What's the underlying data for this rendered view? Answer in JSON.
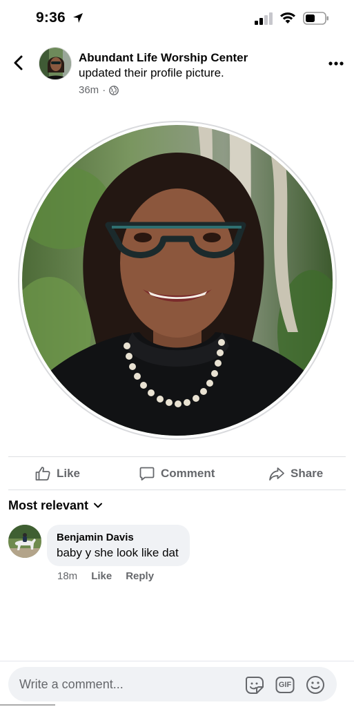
{
  "status_bar": {
    "time": "9:36"
  },
  "post": {
    "page_name": "Abundant Life Worship Center",
    "action_text": "updated their profile picture.",
    "time_ago": "36m",
    "separator": "·"
  },
  "actions": {
    "like": "Like",
    "comment": "Comment",
    "share": "Share"
  },
  "sort": {
    "label": "Most relevant"
  },
  "comments": [
    {
      "author": "Benjamin Davis",
      "text": "baby y she look like dat",
      "time": "18m",
      "like": "Like",
      "reply": "Reply"
    }
  ],
  "composer": {
    "placeholder": "Write a comment...",
    "gif_label": "GIF"
  },
  "colors": {
    "secondary_text": "#65676b",
    "bubble": "#f0f2f5",
    "divider": "#dddfe2"
  }
}
